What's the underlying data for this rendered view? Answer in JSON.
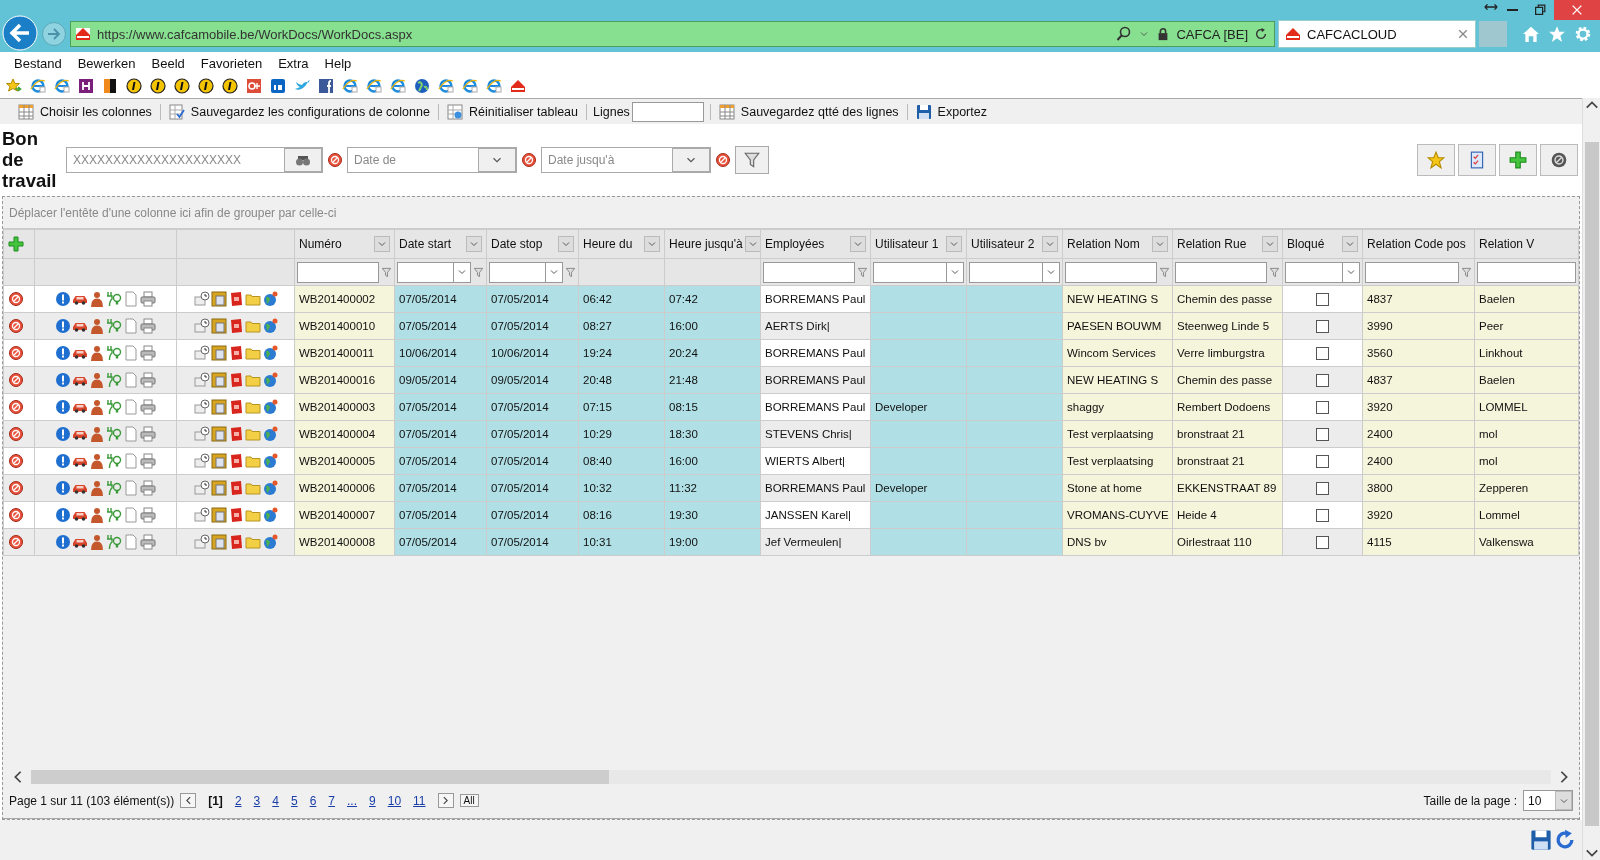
{
  "browser": {
    "url": "https://www.cafcamobile.be/WorkDocs/WorkDocs.aspx",
    "site_identity": "CAFCA [BE]",
    "tabs": [
      {
        "label": "CAFCACLOUD",
        "selected": true
      }
    ]
  },
  "menu": [
    "Bestand",
    "Bewerken",
    "Beeld",
    "Favorieten",
    "Extra",
    "Help"
  ],
  "toolbar": [
    {
      "kind": "columns",
      "label": "Choisir les colonnes"
    },
    {
      "kind": "save-config",
      "label": "Sauvegardez les configurations de colonne"
    },
    {
      "kind": "reset",
      "label": "Réinitialiser tableau"
    },
    {
      "kind": "lines",
      "label": "Lignes"
    },
    {
      "kind": "save-lines",
      "label": "Sauvegardez qtté des lignes"
    },
    {
      "kind": "export",
      "label": "Exportez"
    }
  ],
  "page_title": "Bon de travail",
  "filters": {
    "search_placeholder": "XXXXXXXXXXXXXXXXXXXXX",
    "date_from_placeholder": "Date de",
    "date_to_placeholder": "Date jusqu'à"
  },
  "group_hint": "Déplacer l'entête d'une colonne ici afin de grouper par celle-ci",
  "grid": {
    "columns": [
      {
        "label": "Numéro",
        "color": "#f5f5dc",
        "menu": true,
        "kind": "text"
      },
      {
        "label": "Date start",
        "color": "#b0e0e6",
        "menu": true,
        "kind": "date"
      },
      {
        "label": "Date stop",
        "color": "#b0e0e6",
        "menu": true,
        "kind": "date"
      },
      {
        "label": "Heure du",
        "color": "#b0e0e6",
        "menu": true,
        "kind": "none"
      },
      {
        "label": "Heure jusqu'à",
        "color": "#b0e0e6",
        "menu": true,
        "kind": "none"
      },
      {
        "label": "Employées",
        "menu": true,
        "kind": "text"
      },
      {
        "label": "Utilisateur 1",
        "color": "#b0e0e6",
        "menu": true,
        "kind": "select"
      },
      {
        "label": "Utilisateur 2",
        "color": "#b0e0e6",
        "menu": true,
        "kind": "select"
      },
      {
        "label": "Relation Nom",
        "color": "#f5f5dc",
        "menu": true,
        "kind": "text"
      },
      {
        "label": "Relation Rue",
        "color": "#f5f5dc",
        "menu": true,
        "kind": "text"
      },
      {
        "label": "Bloqué",
        "menu": true,
        "kind": "select"
      },
      {
        "label": "Relation Code pos",
        "color": "#f5f5dc",
        "menu": false,
        "kind": "text"
      },
      {
        "label": "Relation V",
        "color": "#f5f5dc",
        "menu": false,
        "kind": "input"
      }
    ],
    "rows": [
      {
        "cells": [
          "WB201400002",
          "07/05/2014",
          "07/05/2014",
          "06:42",
          "07:42",
          "BORREMANS Paul",
          "",
          "",
          "NEW HEATING S",
          "Chemin des passe",
          {
            "checked": false
          },
          "4837",
          "Baelen"
        ]
      },
      {
        "cells": [
          "WB201400010",
          "07/05/2014",
          "07/05/2014",
          "08:27",
          "16:00",
          "AERTS Dirk|",
          "",
          "",
          "PAESEN BOUWM",
          "Steenweg Linde 5",
          {
            "checked": false
          },
          "3990",
          "Peer"
        ]
      },
      {
        "cells": [
          "WB201400011",
          "10/06/2014",
          "10/06/2014",
          "19:24",
          "20:24",
          "BORREMANS Paul",
          "",
          "",
          "Wincom Services",
          "Verre limburgstra",
          {
            "checked": false
          },
          "3560",
          "Linkhout"
        ]
      },
      {
        "cells": [
          "WB201400016",
          "09/05/2014",
          "09/05/2014",
          "20:48",
          "21:48",
          "BORREMANS Paul",
          "",
          "",
          "NEW HEATING S",
          "Chemin des passe",
          {
            "checked": false
          },
          "4837",
          "Baelen"
        ]
      },
      {
        "cells": [
          "WB201400003",
          "07/05/2014",
          "07/05/2014",
          "07:15",
          "08:15",
          "BORREMANS Paul",
          "Developer",
          "",
          "shaggy",
          "Rembert Dodoens",
          {
            "checked": false
          },
          "3920",
          "LOMMEL"
        ]
      },
      {
        "cells": [
          "WB201400004",
          "07/05/2014",
          "07/05/2014",
          "10:29",
          "18:30",
          "STEVENS Chris|",
          "",
          "",
          "Test verplaatsing",
          "bronstraat 21",
          {
            "checked": false
          },
          "2400",
          "mol"
        ]
      },
      {
        "cells": [
          "WB201400005",
          "07/05/2014",
          "07/05/2014",
          "08:40",
          "16:00",
          "WIERTS Albert|",
          "",
          "",
          "Test verplaatsing",
          "bronstraat 21",
          {
            "checked": false
          },
          "2400",
          "mol"
        ]
      },
      {
        "cells": [
          "WB201400006",
          "07/05/2014",
          "07/05/2014",
          "10:32",
          "11:32",
          "BORREMANS Paul",
          "Developer",
          "",
          "Stone at home",
          "EKKENSTRAAT 89",
          {
            "checked": false
          },
          "3800",
          "Zepperen"
        ]
      },
      {
        "cells": [
          "WB201400007",
          "07/05/2014",
          "07/05/2014",
          "08:16",
          "19:30",
          "JANSSEN Karel|",
          "",
          "",
          "VROMANS-CUYVE",
          "Heide 4",
          {
            "checked": false
          },
          "3920",
          "Lommel"
        ]
      },
      {
        "cells": [
          "WB201400008",
          "07/05/2014",
          "07/05/2014",
          "10:31",
          "19:00",
          "Jef Vermeulen|",
          "",
          "",
          "DNS bv",
          "Oirlestraat 110",
          {
            "checked": false
          },
          "4115",
          "Valkenswa"
        ]
      }
    ]
  },
  "pager": {
    "summary": "Page 1 sur 11 (103 élément(s))",
    "pages": [
      {
        "label": "[1]",
        "selected": true
      },
      {
        "label": "2",
        "selected": false
      },
      {
        "label": "3",
        "selected": false
      },
      {
        "label": "4",
        "selected": false
      },
      {
        "label": "5",
        "selected": false
      },
      {
        "label": "6",
        "selected": false
      },
      {
        "label": "7",
        "selected": false
      },
      {
        "label": "...",
        "selected": false
      },
      {
        "label": "9",
        "selected": false
      },
      {
        "label": "10",
        "selected": false
      },
      {
        "label": "11",
        "selected": false
      }
    ],
    "all_label": "All",
    "page_size_label": "Taille de la page :",
    "page_size": "10"
  }
}
